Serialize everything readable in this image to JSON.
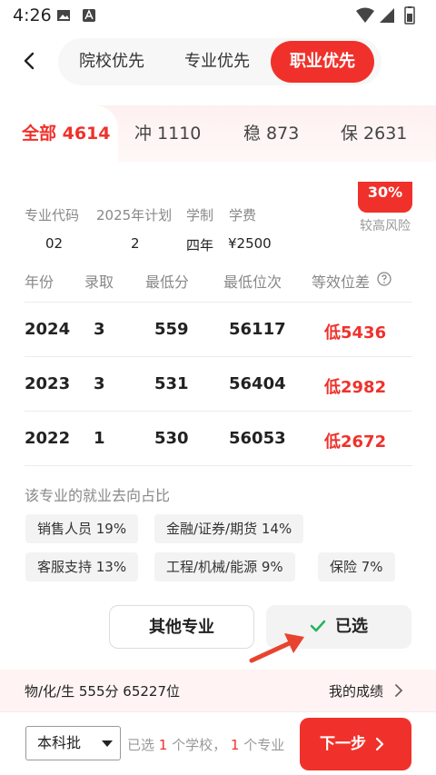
{
  "status_bar": {
    "time": "4:26"
  },
  "header": {
    "segments": [
      "院校优先",
      "专业优先",
      "职业优先"
    ],
    "active_segment": "职业优先"
  },
  "filter": {
    "tabs": [
      {
        "label": "全部 4614",
        "active": true
      },
      {
        "label": "冲 1110",
        "active": false
      },
      {
        "label": "稳 873",
        "active": false
      },
      {
        "label": "保 2631",
        "active": false
      }
    ]
  },
  "major": {
    "risk_percent": "30%",
    "risk_label": "较高风险",
    "fields": {
      "code_label": "专业代码",
      "code_value": "02",
      "plan_label": "2025年计划",
      "plan_value": "2",
      "duration_label": "学制",
      "duration_value": "四年",
      "fee_label": "学费",
      "fee_value": "¥2500"
    },
    "table": {
      "headers": [
        "年份",
        "录取",
        "最低分",
        "最低位次",
        "等效位差"
      ],
      "rows": [
        {
          "year": "2024",
          "admit": "3",
          "min_score": "559",
          "min_rank": "56117",
          "diff": "低5436"
        },
        {
          "year": "2023",
          "admit": "3",
          "min_score": "531",
          "min_rank": "56404",
          "diff": "低2982"
        },
        {
          "year": "2022",
          "admit": "1",
          "min_score": "530",
          "min_rank": "56053",
          "diff": "低2672"
        }
      ]
    },
    "employment": {
      "title": "该专业的就业去向占比",
      "tags": [
        "销售人员 19%",
        "金融/证券/期货 14%",
        "客服支持 13%",
        "工程/机械/能源 9%",
        "保险 7%"
      ]
    }
  },
  "actions": {
    "other": "其他专业",
    "selected": "已选"
  },
  "score_bar": {
    "subjects": "物/化/生 555分  65227位",
    "my_score": "我的成绩"
  },
  "bottom": {
    "batch": "本科批",
    "selected_prefix": "已选",
    "school_count": "1",
    "school_text": "个学校，",
    "major_count": "1",
    "major_text": "个专业",
    "next": "下一步"
  },
  "colors": {
    "accent": "#f0312b"
  }
}
